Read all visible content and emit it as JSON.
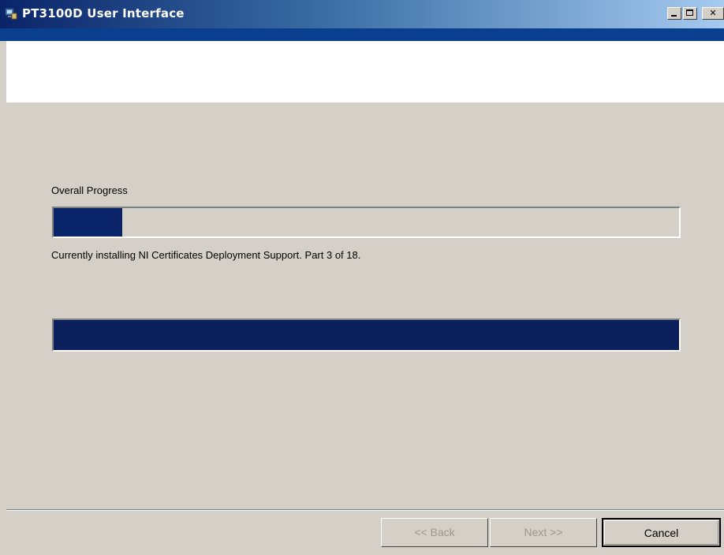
{
  "window": {
    "title": "PT3100D User Interface",
    "icon": "installer-computer-icon"
  },
  "controls": {
    "minimize": "minimize",
    "maximize": "maximize",
    "close": "✕"
  },
  "progress": {
    "label": "Overall Progress",
    "overall_fraction": 0.11,
    "status": "Currently installing NI Certificates Deployment Support.  Part 3 of 18.",
    "current_fraction": 1.0
  },
  "buttons": {
    "back": "<< Back",
    "next": "Next >>",
    "cancel": "Cancel"
  },
  "colors": {
    "title_start": "#0a246a",
    "title_end": "#a6caf0",
    "progress_fill": "#0a246a",
    "face": "#d4d0c8"
  }
}
